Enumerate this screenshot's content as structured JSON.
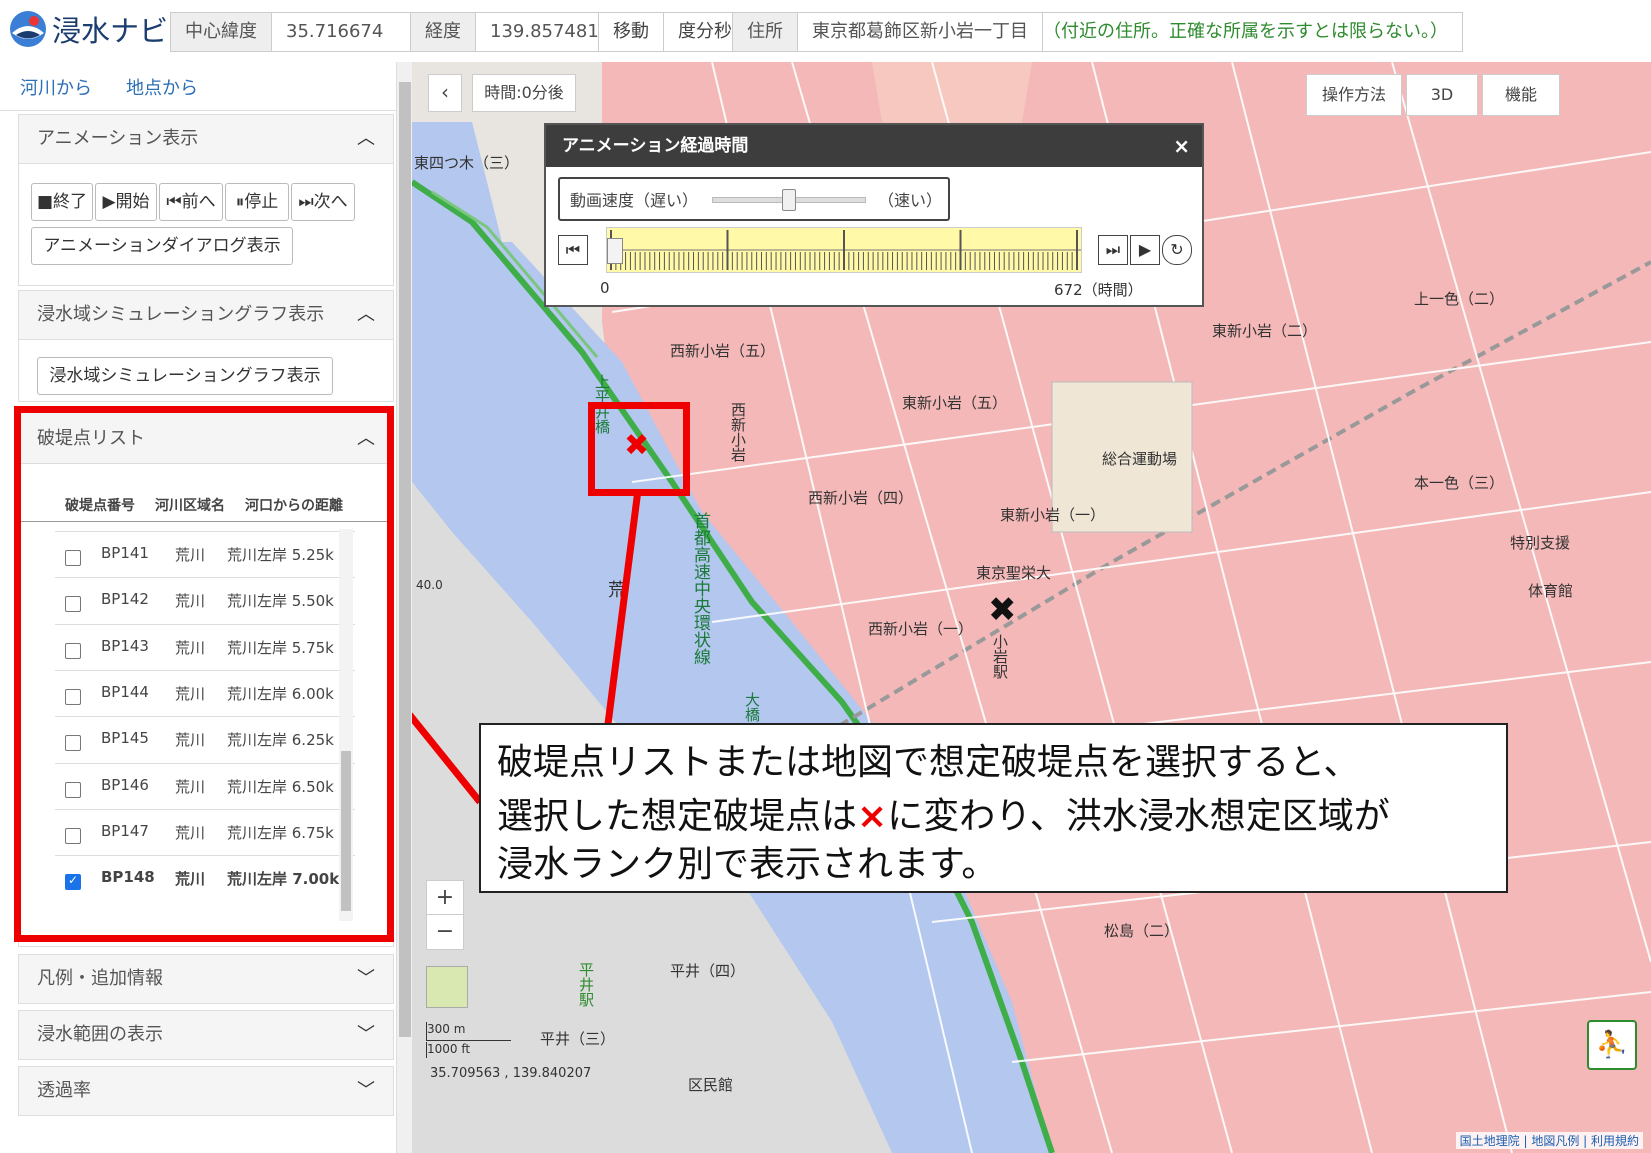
{
  "header": {
    "app_title": "浸水ナビ",
    "lat_label": "中心緯度",
    "lat_value": "35.716674",
    "lon_label": "経度",
    "lon_value": "139.857481",
    "move_label": "移動",
    "dms_label": "度分秒",
    "address_label": "住所",
    "address_value": "東京都葛飾区新小岩一丁目",
    "address_note": "（付近の住所。正確な所属を示すとは限らない。）"
  },
  "sidebar": {
    "tabs": [
      "河川から",
      "地点から"
    ],
    "animation": {
      "title": "アニメーション表示",
      "buttons": [
        "■終了",
        "▶開始",
        "⏮前へ",
        "⏸停止",
        "⏭次へ"
      ],
      "dialog_button": "アニメーションダイアログ表示"
    },
    "graph": {
      "title": "浸水域シミュレーショングラフ表示",
      "button": "浸水域シミュレーショングラフ表示"
    },
    "bp_list": {
      "title": "破堤点リスト",
      "columns": [
        "破堤点番号",
        "河川区域名",
        "河口からの距離"
      ],
      "rows": [
        {
          "id": "BP141",
          "river": "荒川",
          "dist": "荒川左岸 5.25k",
          "checked": false
        },
        {
          "id": "BP142",
          "river": "荒川",
          "dist": "荒川左岸 5.50k",
          "checked": false
        },
        {
          "id": "BP143",
          "river": "荒川",
          "dist": "荒川左岸 5.75k",
          "checked": false
        },
        {
          "id": "BP144",
          "river": "荒川",
          "dist": "荒川左岸 6.00k",
          "checked": false
        },
        {
          "id": "BP145",
          "river": "荒川",
          "dist": "荒川左岸 6.25k",
          "checked": false
        },
        {
          "id": "BP146",
          "river": "荒川",
          "dist": "荒川左岸 6.50k",
          "checked": false
        },
        {
          "id": "BP147",
          "river": "荒川",
          "dist": "荒川左岸 6.75k",
          "checked": false
        },
        {
          "id": "BP148",
          "river": "荒川",
          "dist": "荒川左岸 7.00k",
          "checked": true
        }
      ]
    },
    "legend_title": "凡例・追加情報",
    "range_title": "浸水範囲の表示",
    "opacity_title": "透過率"
  },
  "map": {
    "time_label": "時間:0分後",
    "buttons": [
      "操作方法",
      "3D",
      "機能"
    ],
    "zoom_in": "+",
    "zoom_out": "−",
    "scale_m": "300 m",
    "scale_ft": "1000 ft",
    "coords": "35.709563 , 139.840207",
    "attribution": "国土地理院 | 地図凡例 | 利用規約",
    "labels": {
      "nishi_shinkoiwa_5": "西新小岩（五）",
      "higashi_shinkoiwa_5": "東新小岩（五）",
      "nishi_shinkoiwa_4": "西新小岩（四）",
      "higashi_shinkoiwa_1": "東新小岩（一）",
      "tokyo_seiei": "東京聖栄大",
      "nishi_shinkoiwa_1": "西新小岩（一）",
      "sogo_undojo": "総合運動場",
      "hirai_4": "平井（四）",
      "hirai_3": "平井（三）",
      "matsushima_2": "松島（二）",
      "higashi_shinkoiwa_2": "東新小岩（二）",
      "kamiichiro_2": "上一色（二）",
      "honichiro_3": "本一色（三）",
      "higashi_yotsugi_3": "東四つ木（三）",
      "kumin_kaikan": "区民館",
      "tokubetsu": "特別支援",
      "taiikukan": "体育館",
      "shinkoiwa_station": "小岩駅",
      "hirai_station": "平井駅",
      "ara": "荒",
      "shutoko": "首都高速中央環状線",
      "ohashi": "大橋",
      "kamihirai": "上平井橋",
      "nishi_shinkoiwa_label": "西新小岩",
      "elev": "40.0"
    },
    "anim_dialog": {
      "title": "アニメーション経過時間",
      "close": "×",
      "speed_label": "動画速度（遅い）",
      "speed_fast": "（速い）",
      "speed_level": 0.5,
      "time_start": "0",
      "time_end": "672（時間）",
      "progress": 0.0
    },
    "annotation": {
      "line1": "破堤点リストまたは地図で想定破堤点を選択すると、",
      "line2a": "選択した想定破堤点は",
      "line2_mark": "×",
      "line2b": "に変わり、洪水浸水想定区域が",
      "line3": "浸水ランク別で表示されます。"
    },
    "colors": {
      "flood": "#f4b4b4",
      "river": "#b3c7ef",
      "highlight": "#e00000"
    }
  }
}
